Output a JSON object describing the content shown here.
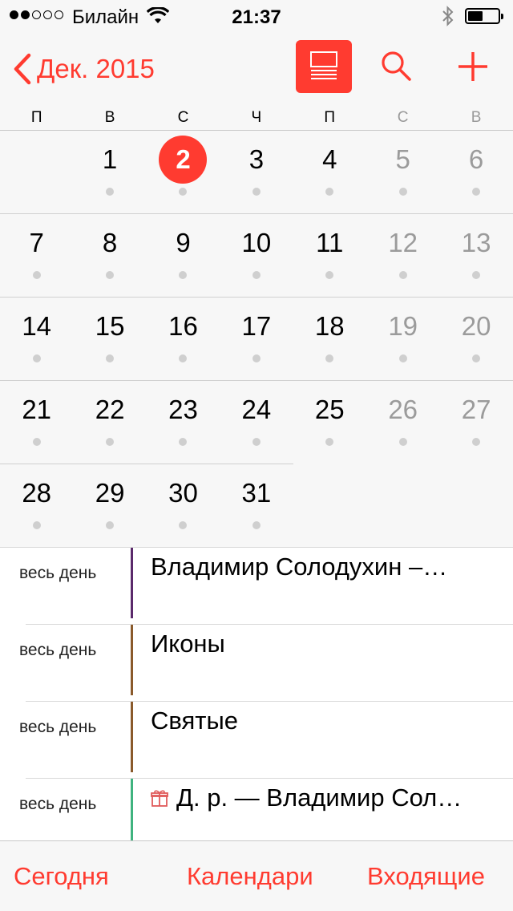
{
  "status": {
    "carrier": "Билайн",
    "time": "21:37"
  },
  "nav": {
    "back_label": "Дек. 2015",
    "accent_color": "#ff3b30"
  },
  "weekdays": [
    {
      "label": "П",
      "weekend": false
    },
    {
      "label": "В",
      "weekend": false
    },
    {
      "label": "С",
      "weekend": false
    },
    {
      "label": "Ч",
      "weekend": false
    },
    {
      "label": "П",
      "weekend": false
    },
    {
      "label": "С",
      "weekend": true
    },
    {
      "label": "В",
      "weekend": true
    }
  ],
  "weeks": [
    [
      null,
      "1",
      "2",
      "3",
      "4",
      "5",
      "6"
    ],
    [
      "7",
      "8",
      "9",
      "10",
      "11",
      "12",
      "13"
    ],
    [
      "14",
      "15",
      "16",
      "17",
      "18",
      "19",
      "20"
    ],
    [
      "21",
      "22",
      "23",
      "24",
      "25",
      "26",
      "27"
    ],
    [
      "28",
      "29",
      "30",
      "31",
      null,
      null,
      null
    ]
  ],
  "selected_day": "2",
  "events": [
    {
      "allday": "весь день",
      "title": "Владимир Солодухин –…",
      "color": "#5b2a6b",
      "icon": null
    },
    {
      "allday": "весь день",
      "title": "Иконы",
      "color": "#8a5a2b",
      "icon": null
    },
    {
      "allday": "весь день",
      "title": "Святые",
      "color": "#8a5a2b",
      "icon": null
    },
    {
      "allday": "весь день",
      "title": "Д. р. — Владимир Сол…",
      "color": "#3fb37f",
      "icon": "gift-icon"
    }
  ],
  "toolbar": {
    "today": "Сегодня",
    "calendars": "Календари",
    "inbox": "Входящие"
  }
}
